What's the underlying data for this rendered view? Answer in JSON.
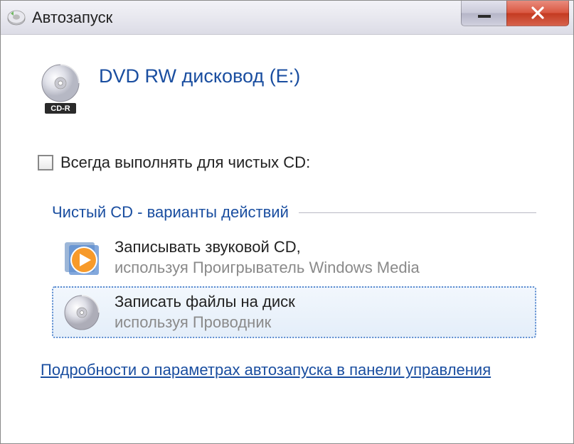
{
  "window": {
    "title": "Автозапуск"
  },
  "drive": {
    "title": "DVD RW дисковод (E:)",
    "media_label": "CD-R"
  },
  "checkbox": {
    "label": "Всегда выполнять для чистых CD:"
  },
  "section": {
    "header": "Чистый CD - варианты действий"
  },
  "actions": [
    {
      "title": "Записывать звуковой CD,",
      "sub": "используя Проигрыватель Windows Media"
    },
    {
      "title": "Записать файлы на диск",
      "sub": "используя Проводник"
    }
  ],
  "footer": {
    "link": "Подробности о параметрах автозапуска в панели управления"
  }
}
